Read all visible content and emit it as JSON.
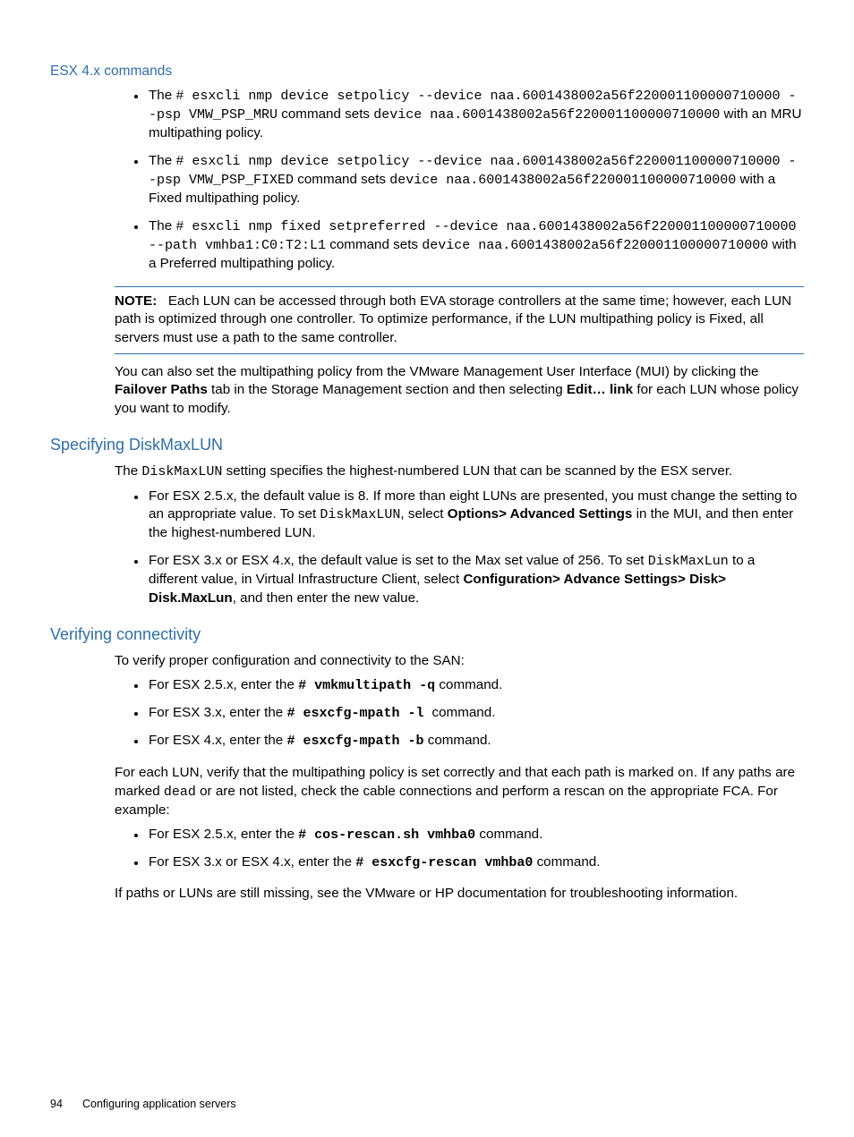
{
  "hdr1": "ESX 4.x commands",
  "cmds": [
    {
      "pre": "The ",
      "code": "# esxcli nmp device setpolicy --device naa.6001438002a56f220001100000710000 --psp VMW_PSP_MRU",
      "mid": " command sets ",
      "code2": "device naa.6001438002a56f220001100000710000",
      "post": " with an MRU multipathing policy."
    },
    {
      "pre": "The ",
      "code": "# esxcli nmp device setpolicy --device naa.6001438002a56f220001100000710000 --psp VMW_PSP_FIXED",
      "mid": " command sets ",
      "code2": "device naa.6001438002a56f220001100000710000",
      "post": " with a Fixed multipathing policy."
    },
    {
      "pre": "The ",
      "code": "# esxcli nmp fixed setpreferred --device naa.6001438002a56f220001100000710000 --path vmhba1:C0:T2:L1",
      "mid": " command sets ",
      "code2": "device naa.6001438002a56f220001100000710000",
      "post": " with a Preferred multipathing policy."
    }
  ],
  "note_label": "NOTE:",
  "note_body": "Each LUN can be accessed through both EVA storage controllers at the same time; however, each LUN path is optimized through one controller. To optimize performance, if the LUN multipathing policy is Fixed, all servers must use a path to the same controller.",
  "mui": {
    "a": "You can also set the multipathing policy from the VMware Management User Interface (MUI) by clicking the ",
    "b": "Failover Paths",
    "c": " tab in the Storage Management section and then selecting ",
    "d": "Edit… link",
    "e": " for each LUN whose policy you want to modify."
  },
  "sec2": {
    "title": "Specifying DiskMaxLUN",
    "intro_a": "The ",
    "intro_code": "DiskMaxLUN",
    "intro_b": " setting specifies the highest-numbered LUN that can be scanned by the ESX server.",
    "b1": {
      "a": "For ESX 2.5.x, the default value is 8. If more than eight LUNs are presented, you must change the setting to an appropriate value. To set ",
      "code": "DiskMaxLUN",
      "b": ", select ",
      "bold": "Options> Advanced Settings",
      "c": " in the MUI, and then enter the highest-numbered LUN."
    },
    "b2": {
      "a": "For ESX 3.x or ESX 4.x, the default value is set to the Max set value of 256. To set ",
      "code": "DiskMaxLun",
      "b": " to a different value, in Virtual Infrastructure Client, select ",
      "bold": "Configuration> Advance Settings> Disk> Disk.MaxLun",
      "c": ", and then enter the new value."
    }
  },
  "sec3": {
    "title": "Verifying connectivity",
    "intro": "To verify proper configuration and connectivity to the SAN:",
    "list1": [
      {
        "a": "For ESX 2.5.x, enter the ",
        "code": "# vmkmultipath -q",
        "b": " command."
      },
      {
        "a": "For ESX 3.x, enter the ",
        "code": "# esxcfg-mpath -l ",
        "b": " command."
      },
      {
        "a": "For ESX 4.x, enter the ",
        "code": "# esxcfg-mpath -b",
        "b": " command."
      }
    ],
    "mid_a": "For each LUN, verify that the multipathing policy is set correctly and that each path is marked ",
    "mid_code1": "on",
    "mid_b": ". If any paths are marked ",
    "mid_code2": "dead",
    "mid_c": " or are not listed, check the cable connections and perform a rescan on the appropriate FCA. For example:",
    "list2": [
      {
        "a": "For ESX 2.5.x, enter the ",
        "code": "# cos-rescan.sh vmhba0",
        "b": " command."
      },
      {
        "a": "For ESX 3.x or ESX 4.x, enter the ",
        "code": "# esxcfg-rescan vmhba0",
        "b": " command."
      }
    ],
    "outro": "If paths or LUNs are still missing, see the VMware or HP documentation for troubleshooting information."
  },
  "footer": {
    "page": "94",
    "title": "Configuring application servers"
  }
}
